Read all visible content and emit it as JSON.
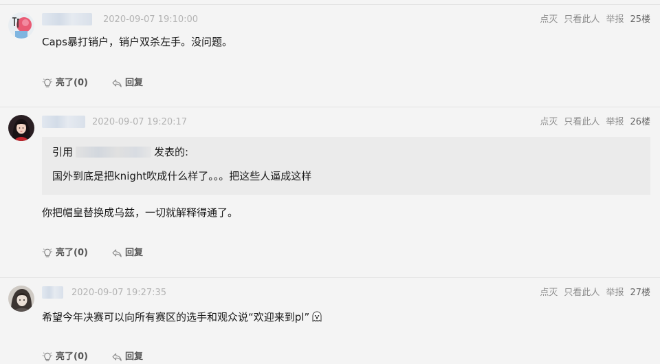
{
  "posts": [
    {
      "timestamp": "2020-09-07 19:10:00",
      "actions": {
        "downvote": "点灭",
        "only_this_user": "只看此人",
        "report": "举报"
      },
      "floor": "25楼",
      "content": "Caps暴打销户，销户双杀左手。没问题。",
      "like_label": "亮了(0)",
      "reply_label": "回复"
    },
    {
      "timestamp": "2020-09-07 19:20:17",
      "actions": {
        "downvote": "点灭",
        "only_this_user": "只看此人",
        "report": "举报"
      },
      "floor": "26楼",
      "quote": {
        "prefix": "引用",
        "suffix": "发表的:",
        "text": "国外到底是把knight吹成什么样了。。。把这些人逼成这样"
      },
      "content": "你把帽皇替换成乌兹，一切就解释得通了。",
      "like_label": "亮了(0)",
      "reply_label": "回复"
    },
    {
      "timestamp": "2020-09-07 19:27:35",
      "actions": {
        "downvote": "点灭",
        "only_this_user": "只看此人",
        "report": "举报"
      },
      "floor": "27楼",
      "content": "希望今年决赛可以向所有赛区的选手和观众说“欢迎来到pl”",
      "content_emoji": "ghost-emoji",
      "like_label": "亮了(0)",
      "reply_label": "回复"
    }
  ],
  "icons": {
    "like": "lightbulb-icon",
    "reply": "reply-arrow-icon"
  },
  "colors": {
    "background": "#f4f4f4",
    "quote_background": "#ebebeb",
    "meta_text": "#8c8c8c",
    "timestamp_text": "#b3b3b3",
    "action_text": "#555555"
  }
}
